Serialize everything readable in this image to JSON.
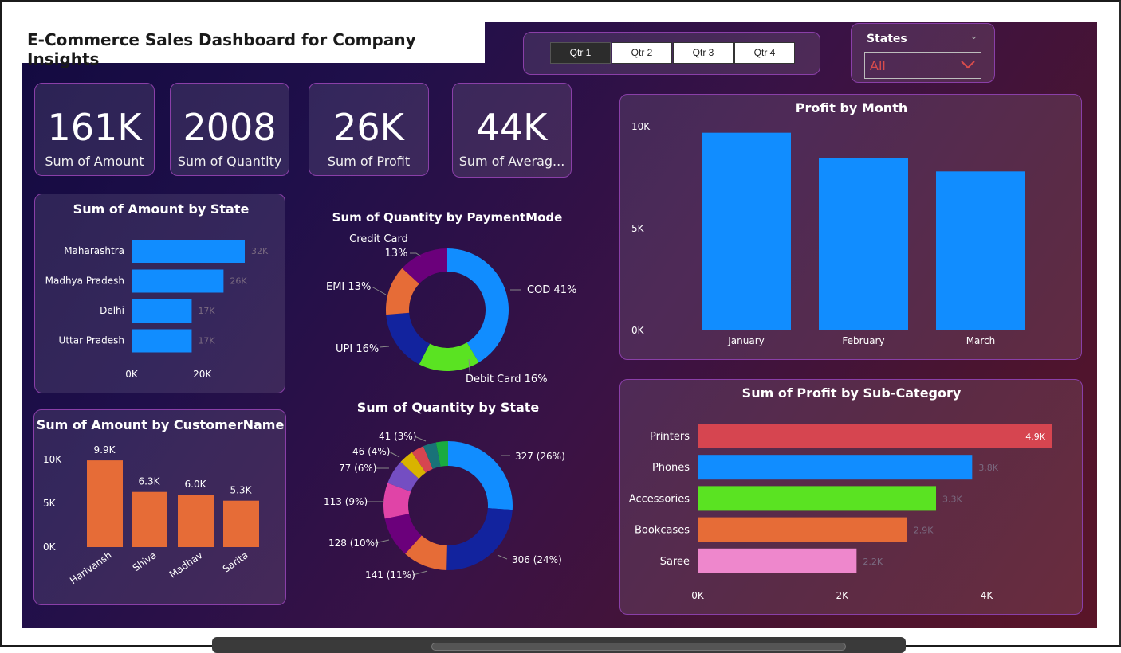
{
  "dashboard": {
    "title": "E-Commerce Sales Dashboard for Company Insights"
  },
  "quarter_slicer": {
    "options": [
      "Qtr 1",
      "Qtr 2",
      "Qtr 3",
      "Qtr 4"
    ],
    "selected": "Qtr 1"
  },
  "states_slicer": {
    "label": "States",
    "value": "All"
  },
  "kpis": [
    {
      "value": "161K",
      "label": "Sum of Amount"
    },
    {
      "value": "2008",
      "label": "Sum of Quantity"
    },
    {
      "value": "26K",
      "label": "Sum of Profit"
    },
    {
      "value": "44K",
      "label": "Sum of Averag..."
    }
  ],
  "colors": {
    "blue": "#118DFF",
    "orange": "#E66C37",
    "red": "#D64550",
    "green": "#5AE322",
    "pink": "#EE87CC",
    "purple": "#6B007B",
    "navy": "#12239E",
    "accent_border": "#8a3fa8"
  },
  "chart_data": [
    {
      "id": "amount_by_state",
      "type": "bar",
      "orientation": "horizontal",
      "title": "Sum of Amount by State",
      "categories": [
        "Maharashtra",
        "Madhya Pradesh",
        "Delhi",
        "Uttar Pradesh"
      ],
      "values": [
        32000,
        26000,
        17000,
        17000
      ],
      "data_labels": [
        "32K",
        "26K",
        "17K",
        "17K"
      ],
      "xticks": [
        "0K",
        "20K"
      ],
      "xlim": [
        0,
        32000
      ]
    },
    {
      "id": "quantity_by_paymentmode",
      "type": "pie",
      "title": "Sum of Quantity by PaymentMode",
      "slices": [
        {
          "label": "COD 41%",
          "value": 41,
          "color": "#118DFF"
        },
        {
          "label": "Debit Card 16%",
          "value": 16,
          "color": "#5AE322"
        },
        {
          "label": "UPI 16%",
          "value": 16,
          "color": "#12239E"
        },
        {
          "label": "EMI 13%",
          "value": 13,
          "color": "#E66C37"
        },
        {
          "label": "Credit Card 13%",
          "value": 13,
          "color": "#6B007B"
        }
      ]
    },
    {
      "id": "profit_by_month",
      "type": "bar",
      "orientation": "vertical",
      "title": "Profit by Month",
      "categories": [
        "January",
        "February",
        "March"
      ],
      "values": [
        9700,
        8450,
        7800
      ],
      "yticks": [
        "0K",
        "5K",
        "10K"
      ],
      "ylim": [
        0,
        10000
      ]
    },
    {
      "id": "amount_by_customer",
      "type": "bar",
      "orientation": "vertical",
      "title": "Sum of Amount by CustomerName",
      "categories": [
        "Harivansh",
        "Shiva",
        "Madhav",
        "Sarita"
      ],
      "values": [
        9900,
        6300,
        6000,
        5300
      ],
      "data_labels": [
        "9.9K",
        "6.3K",
        "6.0K",
        "5.3K"
      ],
      "yticks": [
        "0K",
        "5K",
        "10K"
      ],
      "ylim": [
        0,
        10000
      ]
    },
    {
      "id": "quantity_by_state",
      "type": "pie",
      "title": "Sum of Quantity by State",
      "slices": [
        {
          "label": "327 (26%)",
          "value": 327,
          "color": "#118DFF"
        },
        {
          "label": "306 (24%)",
          "value": 306,
          "color": "#12239E"
        },
        {
          "label": "141 (11%)",
          "value": 141,
          "color": "#E66C37"
        },
        {
          "label": "128 (10%)",
          "value": 128,
          "color": "#6B007B"
        },
        {
          "label": "113 (9%)",
          "value": 113,
          "color": "#E044A7"
        },
        {
          "label": "77 (6%)",
          "value": 77,
          "color": "#744EC2"
        },
        {
          "label": "46 (4%)",
          "value": 46,
          "color": "#D9B300"
        },
        {
          "label": "",
          "value": 40,
          "color": "#D64550"
        },
        {
          "label": "41 (3%)",
          "value": 41,
          "color": "#197278"
        },
        {
          "label": "",
          "value": 38,
          "color": "#1AAB40"
        }
      ]
    },
    {
      "id": "profit_by_subcategory",
      "type": "bar",
      "orientation": "horizontal",
      "title": "Sum of Profit by Sub-Category",
      "categories": [
        "Printers",
        "Phones",
        "Accessories",
        "Bookcases",
        "Saree"
      ],
      "values": [
        4900,
        3800,
        3300,
        2900,
        2200
      ],
      "data_labels": [
        "4.9K",
        "3.8K",
        "3.3K",
        "2.9K",
        "2.2K"
      ],
      "bar_colors": [
        "#D64550",
        "#118DFF",
        "#5AE322",
        "#E66C37",
        "#EE87CC"
      ],
      "xticks": [
        "0K",
        "2K",
        "4K"
      ],
      "xlim": [
        0,
        4900
      ]
    }
  ]
}
